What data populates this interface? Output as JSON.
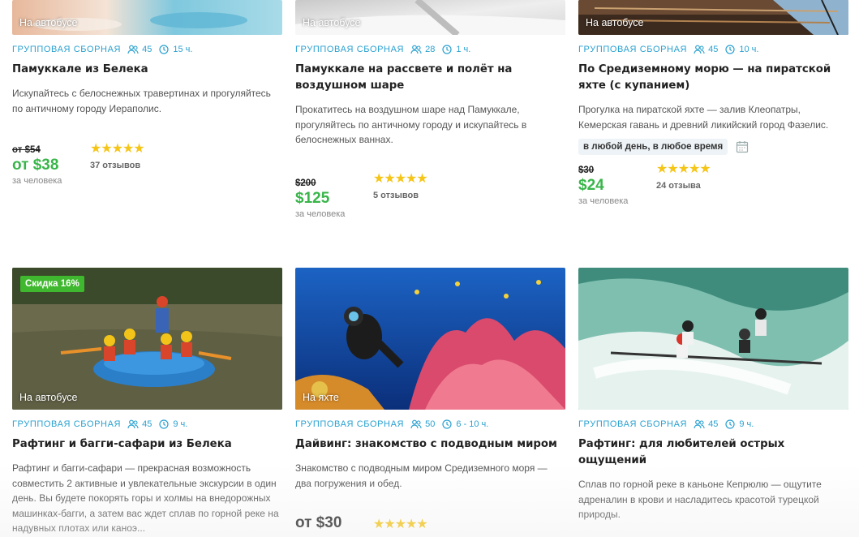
{
  "cards": [
    {
      "overlay": "На автобусе",
      "type": "Групповая сборная",
      "group": "45",
      "duration": "15 ч.",
      "title": "Памуккале из Белека",
      "desc": "Искупайтесь с белоснежных травертинах и прогуляйтесь по античному городу Иераполис.",
      "old_price": "от $54",
      "price": "от $38",
      "per": "за человека",
      "rating": 5,
      "stars": "★★★★★",
      "reviews": "37 отзывов"
    },
    {
      "overlay": "На автобусе",
      "type": "Групповая сборная",
      "group": "28",
      "duration": "1 ч.",
      "title": "Памуккале на рассвете и полёт на воздушном шаре",
      "desc": "Прокатитесь на воздушном шаре над Памуккале, прогуляйтесь по античному городу и искупайтесь в белоснежных ваннах.",
      "old_price": "$200",
      "price": "$125",
      "per": "за человека",
      "rating": 5,
      "stars": "★★★★★",
      "reviews": "5 отзывов"
    },
    {
      "overlay": "На автобусе",
      "type": "Групповая сборная",
      "group": "45",
      "duration": "10 ч.",
      "title": "По Средиземному морю — на пиратской яхте (с купанием)",
      "desc": "Прогулка на пиратской яхте — залив Клеопатры, Кемерская гавань и древний ликийский город Фазелис.",
      "chip": "в любой день, в любое время",
      "old_price": "$30",
      "price": "$24",
      "per": "за человека",
      "rating": 5,
      "stars": "★★★★★",
      "reviews": "24 отзыва"
    },
    {
      "overlay": "На автобусе",
      "badge": "Скидка 16%",
      "type": "Групповая сборная",
      "group": "45",
      "duration": "9 ч.",
      "title": "Рафтинг и багги-сафари из Белека",
      "desc": "Рафтинг и багги-сафари — прекрасная возможность совместить 2 активные и увлекательные экскурсии в один день. Вы будете покорять горы и холмы на внедорожных машинках-багги, а затем вас ждет сплав по горной реке на надувных плотах или каноэ..."
    },
    {
      "overlay": "На яхте",
      "type": "Групповая сборная",
      "group": "50",
      "duration": "6 - 10 ч.",
      "title": "Дайвинг: знакомство с подводным миром",
      "desc": "Знакомство с подводным миром Средиземного моря — два погружения и обед.",
      "price": "от $30",
      "rating": 5,
      "stars": "★★★★★"
    },
    {
      "type": "Групповая сборная",
      "group": "45",
      "duration": "9 ч.",
      "title": "Рафтинг: для любителей острых ощущений",
      "desc": "Сплав по горной реке в каньоне Кепрюлю — ощутите адреналин в крови и насладитесь красотой турецкой природы."
    }
  ],
  "colors": {
    "accent": "#2aa1d0",
    "price": "#39b54a",
    "badge": "#3fb72e",
    "stars": "#f5c518"
  },
  "icons": {
    "group": "group-icon",
    "duration": "clock-icon",
    "calendar": "calendar-icon"
  }
}
